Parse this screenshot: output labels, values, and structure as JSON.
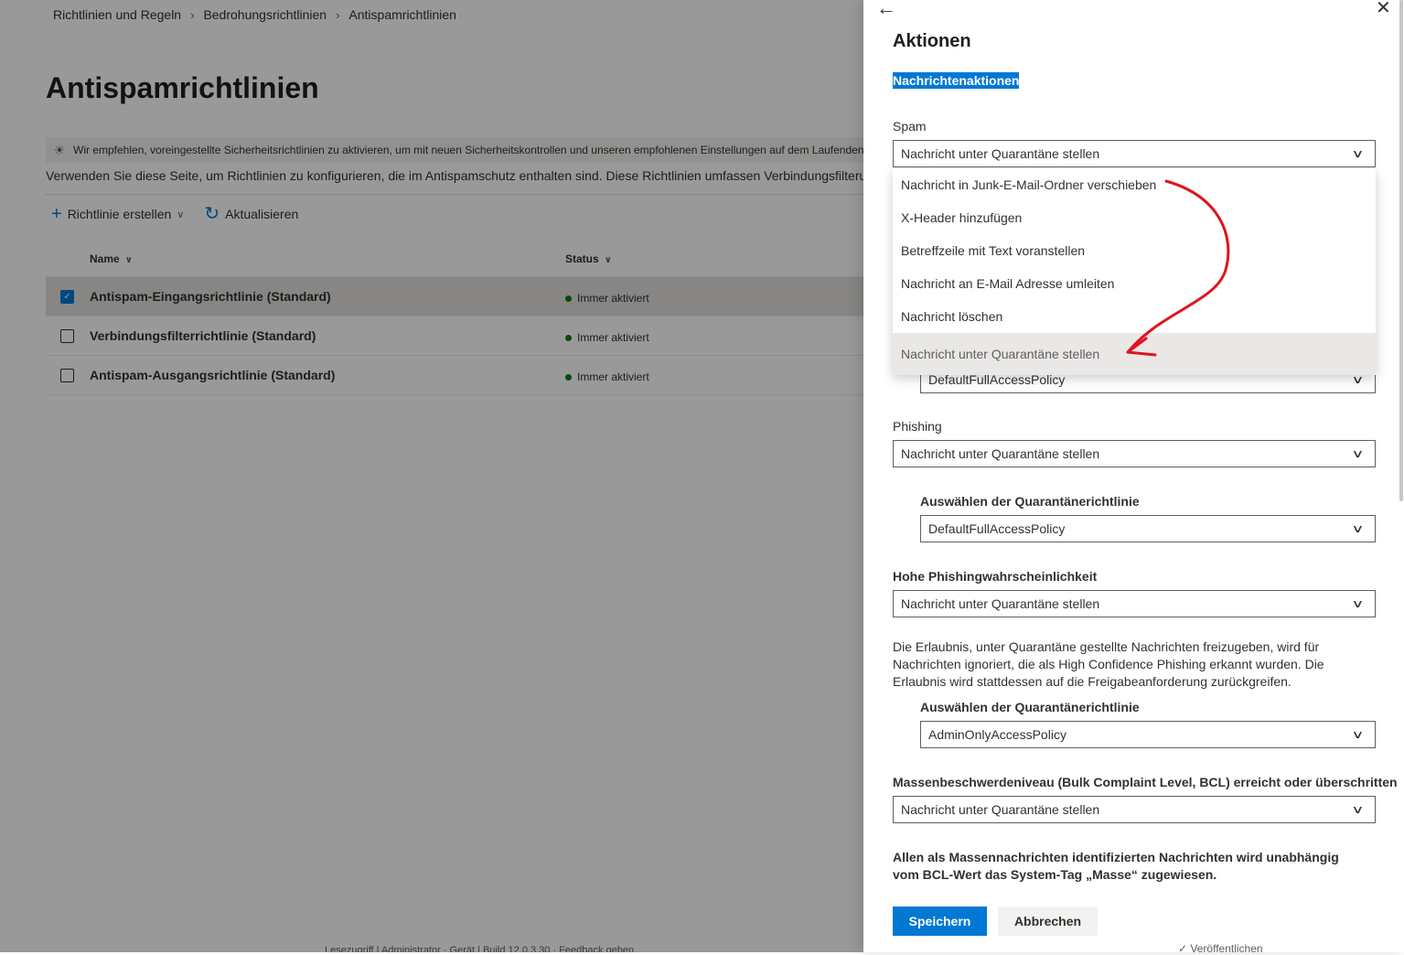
{
  "breadcrumb": [
    "Richtlinien und Regeln",
    "Bedrohungsrichtlinien",
    "Antispamrichtlinien"
  ],
  "page_title": "Antispamrichtlinien",
  "banner_text": "Wir empfehlen, voreingestellte Sicherheitsrichtlinien zu aktivieren, um mit neuen Sicherheitskontrollen und unseren empfohlenen Einstellungen auf dem Laufenden",
  "description": "Verwenden Sie diese Seite, um Richtlinien zu konfigurieren, die im Antispamschutz enthalten sind. Diese Richtlinien umfassen Verbindungsfilterung",
  "toolbar": {
    "create_label": "Richtlinie erstellen",
    "refresh_label": "Aktualisieren"
  },
  "table": {
    "columns": [
      "Name",
      "Status"
    ],
    "rows": [
      {
        "name": "Antispam-Eingangsrichtlinie (Standard)",
        "status": "Immer aktiviert",
        "selected": true
      },
      {
        "name": "Verbindungsfilterrichtlinie (Standard)",
        "status": "Immer aktiviert",
        "selected": false
      },
      {
        "name": "Antispam-Ausgangsrichtlinie (Standard)",
        "status": "Immer aktiviert",
        "selected": false
      }
    ]
  },
  "footer_fragment": "Lesezugriff | Administrator · Gerät | Build 12.0.3.30 · Feedback geben",
  "footer_fragment_right": "✓ Veröffentlichen",
  "panel": {
    "title": "Aktionen",
    "subtitle": "Nachrichtenaktionen",
    "spam_label": "Spam",
    "spam_value": "Nachricht unter Quarantäne stellen",
    "spam_options": [
      "Nachricht in Junk-E-Mail-Ordner verschieben",
      "X-Header hinzufügen",
      "Betreffzeile mit Text voranstellen",
      "Nachricht an E-Mail Adresse umleiten",
      "Nachricht löschen",
      "Nachricht unter Quarantäne stellen"
    ],
    "spam_quarantine_value": "DefaultFullAccessPolicy",
    "phishing_label": "Phishing",
    "phishing_value": "Nachricht unter Quarantäne stellen",
    "quarantine_label": "Auswählen der Quarantänerichtlinie",
    "phishing_quarantine_value": "DefaultFullAccessPolicy",
    "high_phish_label": "Hohe Phishingwahrscheinlichkeit",
    "high_phish_value": "Nachricht unter Quarantäne stellen",
    "high_phish_info": "Die Erlaubnis, unter Quarantäne gestellte Nachrichten freizugeben, wird für Nachrichten ignoriert, die als High Confidence Phishing erkannt wurden. Die Erlaubnis wird stattdessen auf die Freigabeanforderung zurückgreifen.",
    "high_phish_quarantine_value": "AdminOnlyAccessPolicy",
    "bcl_label": "Massenbeschwerdeniveau (Bulk Complaint Level, BCL) erreicht oder überschritten",
    "bcl_value": "Nachricht unter Quarantäne stellen",
    "bulk_info": "Allen als Massennachrichten identifizierten Nachrichten wird unabhängig vom BCL-Wert das System-Tag „Masse“ zugewiesen.",
    "save_label": "Speichern",
    "cancel_label": "Abbrechen"
  },
  "colors": {
    "accent": "#0078d4",
    "status_green": "#107c10",
    "annotation_red": "#e0141e"
  },
  "icons": {
    "back": "arrow-left-icon",
    "close": "close-icon",
    "bulb": "lightbulb-icon",
    "add": "plus-icon",
    "refresh": "refresh-icon"
  }
}
